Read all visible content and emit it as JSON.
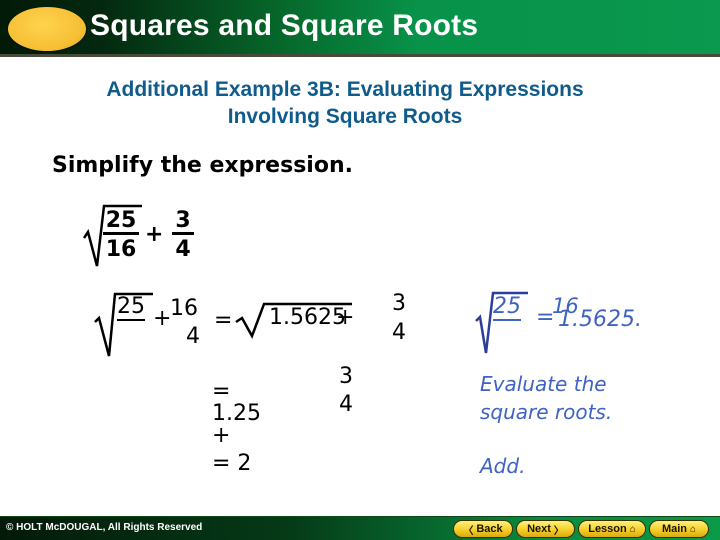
{
  "header": {
    "title": "Squares and Square Roots"
  },
  "subtitle": {
    "line1": "Additional Example 3B: Evaluating Expressions",
    "line2": "Involving Square Roots"
  },
  "prompt": "Simplify the expression.",
  "expression": {
    "radicand_num": "25",
    "radicand_den": "16",
    "plus": "+",
    "frac_num": "3",
    "frac_den": "4"
  },
  "step1": {
    "radicand_num": "25",
    "radicand_den": "16",
    "plus": "+",
    "frac_den": "4",
    "equals": "=",
    "decimal_radicand": "1.5625",
    "plus2": "+",
    "frac2_num": "3",
    "frac2_den": "4"
  },
  "step1_note": {
    "radicand_num": "25",
    "radicand_den": "16",
    "equals": "=",
    "value": "1.5625."
  },
  "step2": {
    "expr": "= 1.25 +",
    "frac_num": "3",
    "frac_den": "4",
    "note_line1": "Evaluate the",
    "note_line2": "square roots."
  },
  "step3": {
    "expr": "= 2",
    "note": "Add."
  },
  "footer": {
    "copyright": "© HOLT McDOUGAL, All Rights Reserved",
    "buttons": [
      {
        "label": "Back",
        "icon": "chevron-left"
      },
      {
        "label": "Next",
        "icon": "chevron-right"
      },
      {
        "label": "Lesson",
        "icon": "home"
      },
      {
        "label": "Main",
        "icon": "home"
      }
    ]
  },
  "colors": {
    "header_green": "#0a994e",
    "oval_yellow": "#f6bf35",
    "subtitle_blue": "#0f5c8c",
    "note_blue": "#3f63c2",
    "button_yellow": "#f5cf2a"
  }
}
